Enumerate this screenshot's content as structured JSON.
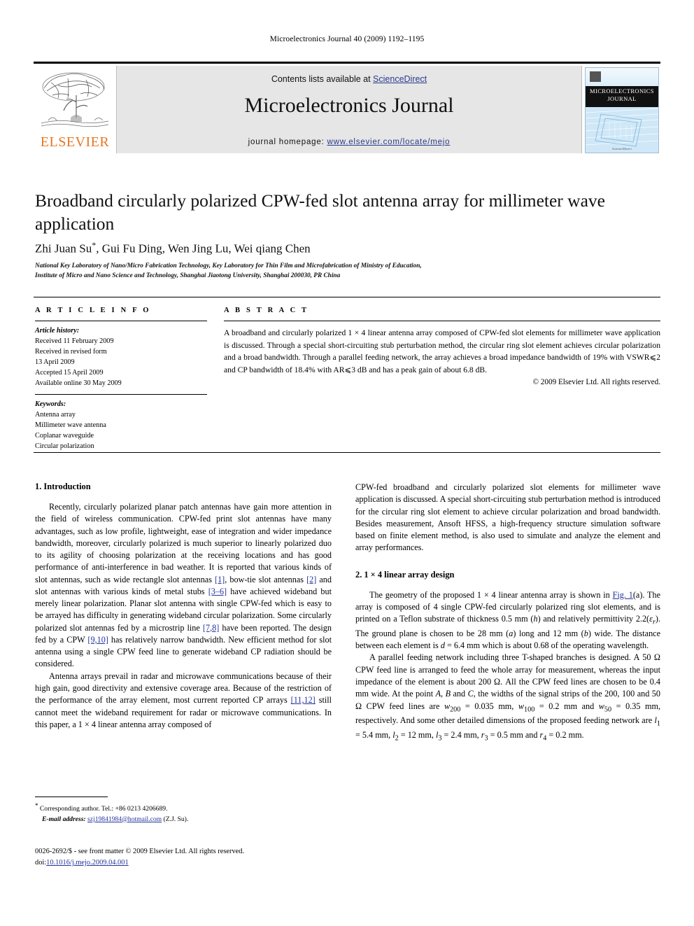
{
  "running_head": "Microelectronics Journal 40 (2009) 1192–1195",
  "masthead": {
    "publisher": "ELSEVIER",
    "contents_prefix": "Contents lists available at ",
    "contents_link": "ScienceDirect",
    "journal_name": "Microelectronics Journal",
    "homepage_prefix": "journal homepage: ",
    "homepage_url": "www.elsevier.com/locate/mejo",
    "cover_title_line1": "MICROELECTRONICS",
    "cover_title_line2": "JOURNAL",
    "cover_footer": "ScienceDirect"
  },
  "article": {
    "title": "Broadband circularly polarized CPW-fed slot antenna array for millimeter wave application",
    "authors": "Zhi Juan Su",
    "authors_rest": ", Gui Fu Ding, Wen Jing Lu, Wei qiang Chen",
    "author_marker": "*",
    "affiliation_line1": "National Key Laboratory of Nano/Micro Fabrication Technology, Key Laboratory for Thin Film and Microfabrication of Ministry of Education,",
    "affiliation_line2": "Institute of Micro and Nano Science and Technology, Shanghai Jiaotong University, Shanghai 200030, PR China"
  },
  "article_info": {
    "heading": "A R T I C L E   I N F O",
    "history_label": "Article history:",
    "history": [
      "Received 11 February 2009",
      "Received in revised form",
      "13 April 2009",
      "Accepted 15 April 2009",
      "Available online 30 May 2009"
    ],
    "keywords_label": "Keywords:",
    "keywords": [
      "Antenna array",
      "Millimeter wave antenna",
      "Coplanar waveguide",
      "Circular polarization"
    ]
  },
  "abstract": {
    "heading": "A B S T R A C T",
    "text": "A broadband and circularly polarized 1 × 4 linear antenna array composed of CPW-fed slot elements for millimeter wave application is discussed. Through a special short-circuiting stub perturbation method, the circular ring slot element achieves circular polarization and a broad bandwidth. Through a parallel feeding network, the array achieves a broad impedance bandwidth of 19% with VSWR⩽2 and CP bandwidth of 18.4% with AR⩽3 dB and has a peak gain of about 6.8 dB.",
    "copyright": "© 2009 Elsevier Ltd. All rights reserved."
  },
  "sections": {
    "intro_heading": "1. Introduction",
    "intro_p1_a": "Recently, circularly polarized planar patch antennas have gain more attention in the field of wireless communication. CPW-fed print slot antennas have many advantages, such as low profile, lightweight, ease of integration and wider impedance bandwidth, moreover, circularly polarized is much superior to linearly polarized duo to its agility of choosing polarization at the receiving locations and has good performance of anti-interference in bad weather. It is reported that various kinds of slot antennas, such as wide rectangle slot antennas ",
    "ref1": "[1]",
    "intro_p1_b": ", bow-tie slot antennas ",
    "ref2": "[2]",
    "intro_p1_c": " and slot antennas with various kinds of metal stubs ",
    "ref36": "[3–6]",
    "intro_p1_d": " have achieved wideband but merely linear polarization. Planar slot antenna with single CPW-fed which is easy to be arrayed has difficulty in generating wideband circular polarization. Some circularly polarized slot antennas fed by a microstrip line ",
    "ref78": "[7,8]",
    "intro_p1_e": " have been reported. The design fed by a CPW ",
    "ref910": "[9,10]",
    "intro_p1_f": " has relatively narrow bandwidth. New efficient method for slot antenna using a single CPW feed line to generate wideband CP radiation should be considered.",
    "intro_p2_a": "Antenna arrays prevail in radar and microwave communications because of their high gain, good directivity and extensive coverage area. Because of the restriction of the performance of the array element, most current reported CP arrays ",
    "ref1112": "[11,12]",
    "intro_p2_b": " still cannot meet the wideband requirement for radar or microwave communications. In this paper, a 1 × 4 linear antenna array composed of",
    "intro_p2_cont": "CPW-fed broadband and circularly polarized slot elements for millimeter wave application is discussed. A special short-circuiting stub perturbation method is introduced for the circular ring slot element to achieve circular polarization and broad bandwidth. Besides measurement, Ansoft HFSS, a high-frequency structure simulation software based on finite element method, is also used to simulate and analyze the element and array performances.",
    "design_heading": "2. 1 × 4 linear array design",
    "design_p1_a": "The geometry of the proposed 1 × 4 linear antenna array is shown in ",
    "fig_link": "Fig. 1",
    "design_p1_b": "(a). The array is composed of 4 single CPW-fed circularly polarized ring slot elements, and is printed on a Teflon substrate of thickness 0.5 mm (",
    "var_h": "h",
    "design_p1_c": ") and relatively permittivity 2.2(",
    "var_eps": "ε",
    "var_eps_sub": "r",
    "design_p1_d": "). The ground plane is chosen to be 28 mm (",
    "var_a": "a",
    "design_p1_e": ") long and 12 mm (",
    "var_b": "b",
    "design_p1_f": ") wide. The distance between each element is ",
    "var_d": "d",
    "design_p1_g": " = 6.4 mm which is about 0.68 of the operating wavelength.",
    "design_p2_a": "A parallel feeding network including three T-shaped branches is designed. A 50 Ω CPW feed line is arranged to feed the whole array for measurement, whereas the input impedance of the element is about 200 Ω. All the CPW feed lines are chosen to be 0.4 mm wide. At the point ",
    "pt_a": "A",
    "design_p2_b": ", ",
    "pt_b": "B",
    "design_p2_c": " and ",
    "pt_c": "C",
    "design_p2_d": ", the widths of the signal strips of the 200, 100 and 50 Ω CPW feed lines are ",
    "w200": "w",
    "w200_sub": "200",
    "design_p2_e": " = 0.035 mm, ",
    "w100": "w",
    "w100_sub": "100",
    "design_p2_f": " = 0.2 mm and ",
    "w50": "w",
    "w50_sub": "50",
    "design_p2_g": " = 0.35 mm, respectively. And some other detailed dimensions of the proposed feeding network are ",
    "l1": "l",
    "l1_sub": "1",
    "design_p2_h": " = 5.4 mm, ",
    "l2": "l",
    "l2_sub": "2",
    "design_p2_i": " = 12 mm, ",
    "l3": "l",
    "l3_sub": "3",
    "design_p2_j": " = 2.4 mm, ",
    "r3": "r",
    "r3_sub": "3",
    "design_p2_k": " = 0.5 mm and ",
    "r4": "r",
    "r4_sub": "4",
    "design_p2_l": " = 0.2 mm."
  },
  "footnote": {
    "marker": "*",
    "corresponding": " Corresponding author. Tel.: +86 0213 4206689.",
    "email_label": "E-mail address:",
    "email": "szj19841984@hotmail.com",
    "email_owner": "(Z.J. Su)."
  },
  "page_footer": {
    "issn_line": "0026-2692/$ - see front matter © 2009 Elsevier Ltd. All rights reserved.",
    "doi_label": "doi:",
    "doi": "10.1016/j.mejo.2009.04.001"
  },
  "colors": {
    "link_blue": "#23339b",
    "elsevier_orange": "#E87722",
    "masthead_gray": "#e6e6e6"
  }
}
